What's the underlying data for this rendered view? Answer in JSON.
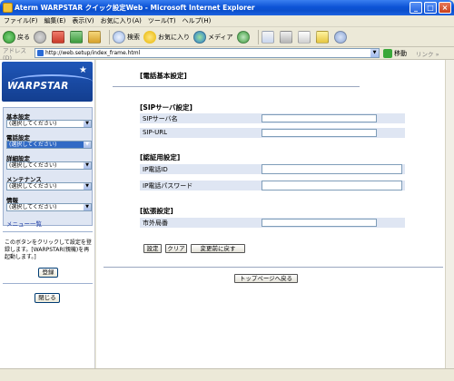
{
  "window": {
    "title": "Aterm WARPSTAR クイック設定Web - Microsoft Internet Explorer",
    "minimize": "_",
    "maximize": "□",
    "close": "×"
  },
  "menubar": {
    "items": [
      "ファイル(F)",
      "編集(E)",
      "表示(V)",
      "お気に入り(A)",
      "ツール(T)",
      "ヘルプ(H)"
    ]
  },
  "toolbar": {
    "back_label": "戻る",
    "search_label": "検索",
    "favorites_label": "お気に入り",
    "media_label": "メディア"
  },
  "addressbar": {
    "label": "アドレス(D)",
    "url": "http://web.setup/index_frame.html",
    "go_label": "移動",
    "links_label": "リンク »"
  },
  "sidebar": {
    "logo_text": "WARPSTAR",
    "sections": [
      {
        "label": "基本設定",
        "select": "(選択してください)"
      },
      {
        "label": "電話設定",
        "select": "(選択してください)"
      },
      {
        "label": "詳細設定",
        "select": "(選択してください)"
      },
      {
        "label": "メンテナンス",
        "select": "(選択してください)"
      },
      {
        "label": "情報",
        "select": "(選択してください)"
      }
    ],
    "menu_list_link": "メニュー一覧",
    "note": "このボタンをクリックして設定を登録します。[WARPSTAR(親機)を再起動します。]",
    "register_button": "登録",
    "close_button": "閉じる"
  },
  "main": {
    "page_title": "[電話基本設定]",
    "sections": [
      {
        "heading": "[SIPサーバ設定]",
        "fields": [
          "SIPサーバ名",
          "SIP-URL"
        ]
      },
      {
        "heading": "[認証用設定]",
        "fields": [
          "IP電話ID",
          "IP電話パスワード"
        ]
      },
      {
        "heading": "[拡張設定]",
        "fields": [
          "市外局番"
        ]
      }
    ],
    "buttons": {
      "set": "設定",
      "clear": "クリア",
      "revert": "変更前に戻す",
      "top_page": "トップページへ戻る"
    }
  }
}
